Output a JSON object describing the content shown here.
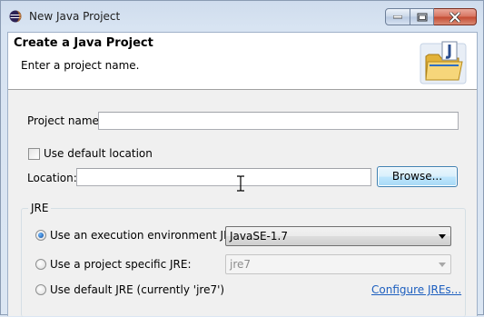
{
  "window": {
    "title": "New Java Project"
  },
  "banner": {
    "title": "Create a Java Project",
    "message": "Enter a project name."
  },
  "form": {
    "project_name_label": "Project name:",
    "project_name_value": "",
    "use_default_location_label": "Use default location",
    "use_default_location_checked": false,
    "location_label": "Location:",
    "location_value": "",
    "browse_label": "Browse..."
  },
  "jre": {
    "group_label": "JRE",
    "options": [
      {
        "label": "Use an execution environment JRE:",
        "selected": true
      },
      {
        "label": "Use a project specific JRE:",
        "selected": false
      },
      {
        "label": "Use default JRE (currently 'jre7')",
        "selected": false
      }
    ],
    "execution_env_value": "JavaSE-1.7",
    "project_jre_value": "jre7",
    "configure_link": "Configure JREs..."
  },
  "icons": {
    "app": "eclipse-icon",
    "banner": "java-project-folder-icon",
    "minimize": "minimize-icon",
    "maximize": "maximize-icon",
    "close": "close-icon",
    "cursor": "text-cursor-icon"
  },
  "colors": {
    "link": "#1d5fbf",
    "focus_border": "#3c7fb1",
    "close_button": "#c44a31"
  }
}
